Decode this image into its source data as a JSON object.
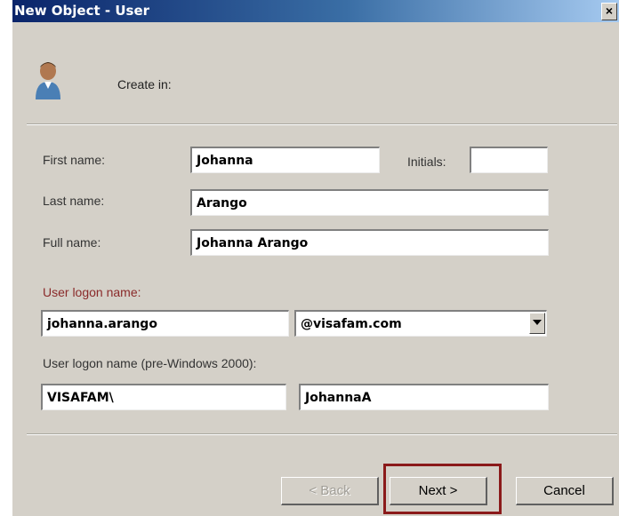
{
  "window": {
    "title": "New Object - User",
    "close_label": "×"
  },
  "header": {
    "create_in_label": "Create in:",
    "icon": "user-icon"
  },
  "form": {
    "first_name_label": "First name:",
    "first_name_value": "Johanna",
    "initials_label": "Initials:",
    "initials_value": "",
    "last_name_label": "Last name:",
    "last_name_value": "Arango",
    "full_name_label": "Full name:",
    "full_name_value": "Johanna Arango",
    "logon_name_label": "User logon name:",
    "logon_name_value": "johanna.arango",
    "domain_value": "@visafam.com",
    "pre2000_label": "User logon name (pre-Windows 2000):",
    "pre2000_domain_value": "VISAFAM\\",
    "pre2000_name_value": "JohannaA"
  },
  "buttons": {
    "back_label": "< Back",
    "next_label": "Next >",
    "cancel_label": "Cancel"
  },
  "colors": {
    "dialog_bg": "#d4d0c8",
    "titlebar_start": "#0a246a",
    "highlight_border": "#8b1a1a"
  }
}
